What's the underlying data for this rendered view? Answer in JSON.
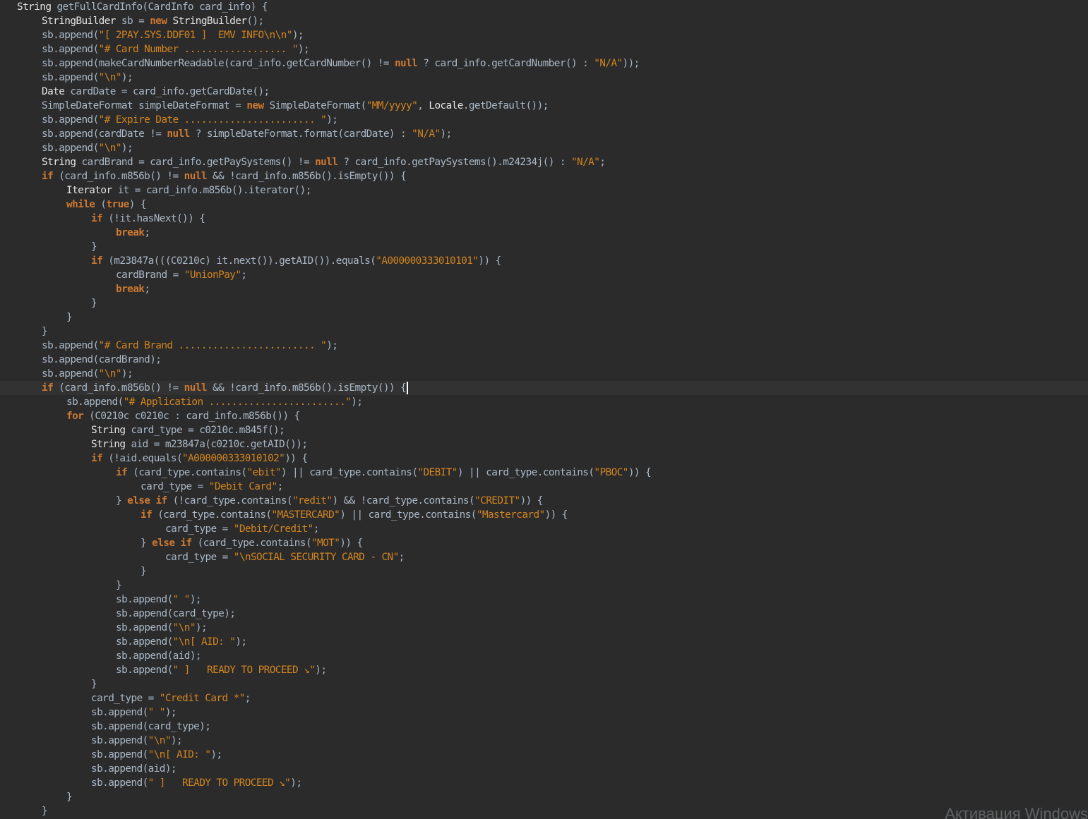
{
  "editor": {
    "theme_colors": {
      "background": "#2b2b2b",
      "current_line": "#323232",
      "text": "#a9b7c6",
      "keyword": "#cc7832",
      "string": "#d2841f",
      "caret": "#ffffff"
    },
    "current_line_index": 27,
    "caret_after_line": 27,
    "lines": [
      {
        "indent": 0,
        "tokens": [
          [
            "type",
            "String"
          ],
          [
            "plain",
            " getFullCardInfo(CardInfo card_info) {"
          ]
        ]
      },
      {
        "indent": 1,
        "tokens": [
          [
            "type",
            "StringBuilder"
          ],
          [
            "plain",
            " sb = "
          ],
          [
            "kwbright",
            "new"
          ],
          [
            "plain",
            " "
          ],
          [
            "type",
            "StringBuilder"
          ],
          [
            "plain",
            "();"
          ]
        ]
      },
      {
        "indent": 1,
        "tokens": [
          [
            "plain",
            "sb.append("
          ],
          [
            "str",
            "\"[ 2PAY.SYS.DDF01 ]  EMV INFO\\n\\n\""
          ],
          [
            "plain",
            ");"
          ]
        ]
      },
      {
        "indent": 1,
        "tokens": [
          [
            "plain",
            "sb.append("
          ],
          [
            "str",
            "\"# Card Number .................. \""
          ],
          [
            "plain",
            ");"
          ]
        ]
      },
      {
        "indent": 1,
        "tokens": [
          [
            "plain",
            "sb.append(makeCardNumberReadable(card_info.getCardNumber() != "
          ],
          [
            "lit",
            "null"
          ],
          [
            "plain",
            " ? card_info.getCardNumber() : "
          ],
          [
            "str",
            "\"N/A\""
          ],
          [
            "plain",
            "));"
          ]
        ]
      },
      {
        "indent": 1,
        "tokens": [
          [
            "plain",
            "sb.append("
          ],
          [
            "str",
            "\"\\n\""
          ],
          [
            "plain",
            ");"
          ]
        ]
      },
      {
        "indent": 1,
        "tokens": [
          [
            "type",
            "Date"
          ],
          [
            "plain",
            " cardDate = card_info.getCardDate();"
          ]
        ]
      },
      {
        "indent": 1,
        "tokens": [
          [
            "plain",
            "SimpleDateFormat simpleDateFormat = "
          ],
          [
            "kwbright",
            "new"
          ],
          [
            "plain",
            " SimpleDateFormat("
          ],
          [
            "str",
            "\"MM/yyyy\""
          ],
          [
            "plain",
            ", "
          ],
          [
            "type",
            "Locale"
          ],
          [
            "plain",
            ".getDefault());"
          ]
        ]
      },
      {
        "indent": 1,
        "tokens": [
          [
            "plain",
            "sb.append("
          ],
          [
            "str",
            "\"# Expire Date ....................... \""
          ],
          [
            "plain",
            ");"
          ]
        ]
      },
      {
        "indent": 1,
        "tokens": [
          [
            "plain",
            "sb.append(cardDate != "
          ],
          [
            "lit",
            "null"
          ],
          [
            "plain",
            " ? simpleDateFormat.format(cardDate) : "
          ],
          [
            "str",
            "\"N/A\""
          ],
          [
            "plain",
            ");"
          ]
        ]
      },
      {
        "indent": 1,
        "tokens": [
          [
            "plain",
            "sb.append("
          ],
          [
            "str",
            "\"\\n\""
          ],
          [
            "plain",
            ");"
          ]
        ]
      },
      {
        "indent": 1,
        "tokens": [
          [
            "type",
            "String"
          ],
          [
            "plain",
            " cardBrand = card_info.getPaySystems() != "
          ],
          [
            "lit",
            "null"
          ],
          [
            "plain",
            " ? card_info.getPaySystems().m24234j() : "
          ],
          [
            "str",
            "\"N/A\""
          ],
          [
            "plain",
            ";"
          ]
        ]
      },
      {
        "indent": 1,
        "tokens": [
          [
            "kwbright",
            "if"
          ],
          [
            "plain",
            " (card_info.m856b() != "
          ],
          [
            "lit",
            "null"
          ],
          [
            "plain",
            " && !card_info.m856b().isEmpty()) {"
          ]
        ]
      },
      {
        "indent": 2,
        "tokens": [
          [
            "type",
            "Iterator"
          ],
          [
            "plain",
            " it = card_info.m856b().iterator();"
          ]
        ]
      },
      {
        "indent": 2,
        "tokens": [
          [
            "kwbright",
            "while"
          ],
          [
            "plain",
            " ("
          ],
          [
            "lit",
            "true"
          ],
          [
            "plain",
            ") {"
          ]
        ]
      },
      {
        "indent": 3,
        "tokens": [
          [
            "kwbright",
            "if"
          ],
          [
            "plain",
            " (!it.hasNext()) {"
          ]
        ]
      },
      {
        "indent": 4,
        "tokens": [
          [
            "kwbright",
            "break"
          ],
          [
            "plain",
            ";"
          ]
        ]
      },
      {
        "indent": 3,
        "tokens": [
          [
            "plain",
            "}"
          ]
        ]
      },
      {
        "indent": 3,
        "tokens": [
          [
            "kwbright",
            "if"
          ],
          [
            "plain",
            " (m23847a(((C0210c) it.next()).getAID()).equals("
          ],
          [
            "str",
            "\"A000000333010101\""
          ],
          [
            "plain",
            ")) {"
          ]
        ]
      },
      {
        "indent": 4,
        "tokens": [
          [
            "plain",
            "cardBrand = "
          ],
          [
            "str",
            "\"UnionPay\""
          ],
          [
            "plain",
            ";"
          ]
        ]
      },
      {
        "indent": 4,
        "tokens": [
          [
            "kwbright",
            "break"
          ],
          [
            "plain",
            ";"
          ]
        ]
      },
      {
        "indent": 3,
        "tokens": [
          [
            "plain",
            "}"
          ]
        ]
      },
      {
        "indent": 2,
        "tokens": [
          [
            "plain",
            "}"
          ]
        ]
      },
      {
        "indent": 1,
        "tokens": [
          [
            "plain",
            "}"
          ]
        ]
      },
      {
        "indent": 1,
        "tokens": [
          [
            "plain",
            "sb.append("
          ],
          [
            "str",
            "\"# Card Brand ........................ \""
          ],
          [
            "plain",
            ");"
          ]
        ]
      },
      {
        "indent": 1,
        "tokens": [
          [
            "plain",
            "sb.append(cardBrand);"
          ]
        ]
      },
      {
        "indent": 1,
        "tokens": [
          [
            "plain",
            "sb.append("
          ],
          [
            "str",
            "\"\\n\""
          ],
          [
            "plain",
            ");"
          ]
        ]
      },
      {
        "indent": 1,
        "tokens": [
          [
            "kwbright",
            "if"
          ],
          [
            "plain",
            " (card_info.m856b() != "
          ],
          [
            "lit",
            "null"
          ],
          [
            "plain",
            " && !card_info.m856b().isEmpty()) {"
          ]
        ]
      },
      {
        "indent": 2,
        "tokens": [
          [
            "plain",
            "sb.append("
          ],
          [
            "str",
            "\"# Application ........................\""
          ],
          [
            "plain",
            ");"
          ]
        ]
      },
      {
        "indent": 2,
        "tokens": [
          [
            "kwbright",
            "for"
          ],
          [
            "plain",
            " (C0210c c0210c : card_info.m856b()) {"
          ]
        ]
      },
      {
        "indent": 3,
        "tokens": [
          [
            "type",
            "String"
          ],
          [
            "plain",
            " card_type = c0210c.m845f();"
          ]
        ]
      },
      {
        "indent": 3,
        "tokens": [
          [
            "type",
            "String"
          ],
          [
            "plain",
            " aid = m23847a(c0210c.getAID());"
          ]
        ]
      },
      {
        "indent": 3,
        "tokens": [
          [
            "kwbright",
            "if"
          ],
          [
            "plain",
            " (!aid.equals("
          ],
          [
            "str",
            "\"A000000333010102\""
          ],
          [
            "plain",
            ")) {"
          ]
        ]
      },
      {
        "indent": 4,
        "tokens": [
          [
            "kwbright",
            "if"
          ],
          [
            "plain",
            " (card_type.contains("
          ],
          [
            "str",
            "\"ebit\""
          ],
          [
            "plain",
            ") || card_type.contains("
          ],
          [
            "str",
            "\"DEBIT\""
          ],
          [
            "plain",
            ") || card_type.contains("
          ],
          [
            "str",
            "\"PBOC\""
          ],
          [
            "plain",
            ")) {"
          ]
        ]
      },
      {
        "indent": 5,
        "tokens": [
          [
            "plain",
            "card_type = "
          ],
          [
            "str",
            "\"Debit Card\""
          ],
          [
            "plain",
            ";"
          ]
        ]
      },
      {
        "indent": 4,
        "tokens": [
          [
            "plain",
            "} "
          ],
          [
            "kwbright",
            "else if"
          ],
          [
            "plain",
            " (!card_type.contains("
          ],
          [
            "str",
            "\"redit\""
          ],
          [
            "plain",
            ") && !card_type.contains("
          ],
          [
            "str",
            "\"CREDIT\""
          ],
          [
            "plain",
            ")) {"
          ]
        ]
      },
      {
        "indent": 5,
        "tokens": [
          [
            "kwbright",
            "if"
          ],
          [
            "plain",
            " (card_type.contains("
          ],
          [
            "str",
            "\"MASTERCARD\""
          ],
          [
            "plain",
            ") || card_type.contains("
          ],
          [
            "str",
            "\"Mastercard\""
          ],
          [
            "plain",
            ")) {"
          ]
        ]
      },
      {
        "indent": 6,
        "tokens": [
          [
            "plain",
            "card_type = "
          ],
          [
            "str",
            "\"Debit/Credit\""
          ],
          [
            "plain",
            ";"
          ]
        ]
      },
      {
        "indent": 5,
        "tokens": [
          [
            "plain",
            "} "
          ],
          [
            "kwbright",
            "else if"
          ],
          [
            "plain",
            " (card_type.contains("
          ],
          [
            "str",
            "\"MOT\""
          ],
          [
            "plain",
            ")) {"
          ]
        ]
      },
      {
        "indent": 6,
        "tokens": [
          [
            "plain",
            "card_type = "
          ],
          [
            "str",
            "\"\\nSOCIAL SECURITY CARD - CN\""
          ],
          [
            "plain",
            ";"
          ]
        ]
      },
      {
        "indent": 5,
        "tokens": [
          [
            "plain",
            "}"
          ]
        ]
      },
      {
        "indent": 4,
        "tokens": [
          [
            "plain",
            "}"
          ]
        ]
      },
      {
        "indent": 4,
        "tokens": [
          [
            "plain",
            "sb.append("
          ],
          [
            "str",
            "\" \""
          ],
          [
            "plain",
            ");"
          ]
        ]
      },
      {
        "indent": 4,
        "tokens": [
          [
            "plain",
            "sb.append(card_type);"
          ]
        ]
      },
      {
        "indent": 4,
        "tokens": [
          [
            "plain",
            "sb.append("
          ],
          [
            "str",
            "\"\\n\""
          ],
          [
            "plain",
            ");"
          ]
        ]
      },
      {
        "indent": 4,
        "tokens": [
          [
            "plain",
            "sb.append("
          ],
          [
            "str",
            "\"\\n[ AID: \""
          ],
          [
            "plain",
            ");"
          ]
        ]
      },
      {
        "indent": 4,
        "tokens": [
          [
            "plain",
            "sb.append(aid);"
          ]
        ]
      },
      {
        "indent": 4,
        "tokens": [
          [
            "plain",
            "sb.append("
          ],
          [
            "str",
            "\" ]   READY TO PROCEED ↘\""
          ],
          [
            "plain",
            ");"
          ]
        ]
      },
      {
        "indent": 3,
        "tokens": [
          [
            "plain",
            "}"
          ]
        ]
      },
      {
        "indent": 3,
        "tokens": [
          [
            "plain",
            "card_type = "
          ],
          [
            "str",
            "\"Credit Card *\""
          ],
          [
            "plain",
            ";"
          ]
        ]
      },
      {
        "indent": 3,
        "tokens": [
          [
            "plain",
            "sb.append("
          ],
          [
            "str",
            "\" \""
          ],
          [
            "plain",
            ");"
          ]
        ]
      },
      {
        "indent": 3,
        "tokens": [
          [
            "plain",
            "sb.append(card_type);"
          ]
        ]
      },
      {
        "indent": 3,
        "tokens": [
          [
            "plain",
            "sb.append("
          ],
          [
            "str",
            "\"\\n\""
          ],
          [
            "plain",
            ");"
          ]
        ]
      },
      {
        "indent": 3,
        "tokens": [
          [
            "plain",
            "sb.append("
          ],
          [
            "str",
            "\"\\n[ AID: \""
          ],
          [
            "plain",
            ");"
          ]
        ]
      },
      {
        "indent": 3,
        "tokens": [
          [
            "plain",
            "sb.append(aid);"
          ]
        ]
      },
      {
        "indent": 3,
        "tokens": [
          [
            "plain",
            "sb.append("
          ],
          [
            "str",
            "\" ]   READY TO PROCEED ↘\""
          ],
          [
            "plain",
            ");"
          ]
        ]
      },
      {
        "indent": 2,
        "tokens": [
          [
            "plain",
            "}"
          ]
        ]
      },
      {
        "indent": 1,
        "tokens": [
          [
            "plain",
            "}"
          ]
        ]
      }
    ]
  },
  "watermark": {
    "text": "Активация Windows"
  }
}
